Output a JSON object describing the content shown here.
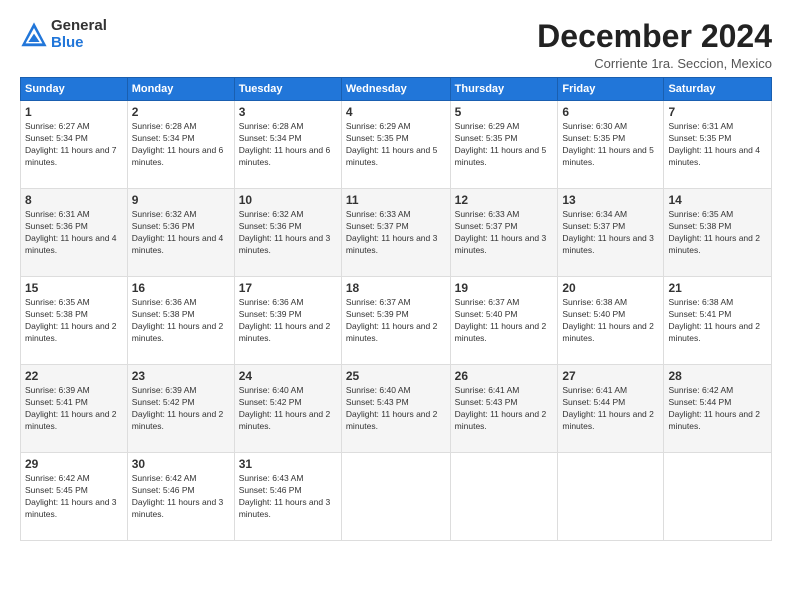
{
  "header": {
    "logo_general": "General",
    "logo_blue": "Blue",
    "month_title": "December 2024",
    "location": "Corriente 1ra. Seccion, Mexico"
  },
  "days_of_week": [
    "Sunday",
    "Monday",
    "Tuesday",
    "Wednesday",
    "Thursday",
    "Friday",
    "Saturday"
  ],
  "weeks": [
    [
      {
        "day": "1",
        "sunrise": "6:27 AM",
        "sunset": "5:34 PM",
        "daylight": "11 hours and 7 minutes."
      },
      {
        "day": "2",
        "sunrise": "6:28 AM",
        "sunset": "5:34 PM",
        "daylight": "11 hours and 6 minutes."
      },
      {
        "day": "3",
        "sunrise": "6:28 AM",
        "sunset": "5:34 PM",
        "daylight": "11 hours and 6 minutes."
      },
      {
        "day": "4",
        "sunrise": "6:29 AM",
        "sunset": "5:35 PM",
        "daylight": "11 hours and 5 minutes."
      },
      {
        "day": "5",
        "sunrise": "6:29 AM",
        "sunset": "5:35 PM",
        "daylight": "11 hours and 5 minutes."
      },
      {
        "day": "6",
        "sunrise": "6:30 AM",
        "sunset": "5:35 PM",
        "daylight": "11 hours and 5 minutes."
      },
      {
        "day": "7",
        "sunrise": "6:31 AM",
        "sunset": "5:35 PM",
        "daylight": "11 hours and 4 minutes."
      }
    ],
    [
      {
        "day": "8",
        "sunrise": "6:31 AM",
        "sunset": "5:36 PM",
        "daylight": "11 hours and 4 minutes."
      },
      {
        "day": "9",
        "sunrise": "6:32 AM",
        "sunset": "5:36 PM",
        "daylight": "11 hours and 4 minutes."
      },
      {
        "day": "10",
        "sunrise": "6:32 AM",
        "sunset": "5:36 PM",
        "daylight": "11 hours and 3 minutes."
      },
      {
        "day": "11",
        "sunrise": "6:33 AM",
        "sunset": "5:37 PM",
        "daylight": "11 hours and 3 minutes."
      },
      {
        "day": "12",
        "sunrise": "6:33 AM",
        "sunset": "5:37 PM",
        "daylight": "11 hours and 3 minutes."
      },
      {
        "day": "13",
        "sunrise": "6:34 AM",
        "sunset": "5:37 PM",
        "daylight": "11 hours and 3 minutes."
      },
      {
        "day": "14",
        "sunrise": "6:35 AM",
        "sunset": "5:38 PM",
        "daylight": "11 hours and 2 minutes."
      }
    ],
    [
      {
        "day": "15",
        "sunrise": "6:35 AM",
        "sunset": "5:38 PM",
        "daylight": "11 hours and 2 minutes."
      },
      {
        "day": "16",
        "sunrise": "6:36 AM",
        "sunset": "5:38 PM",
        "daylight": "11 hours and 2 minutes."
      },
      {
        "day": "17",
        "sunrise": "6:36 AM",
        "sunset": "5:39 PM",
        "daylight": "11 hours and 2 minutes."
      },
      {
        "day": "18",
        "sunrise": "6:37 AM",
        "sunset": "5:39 PM",
        "daylight": "11 hours and 2 minutes."
      },
      {
        "day": "19",
        "sunrise": "6:37 AM",
        "sunset": "5:40 PM",
        "daylight": "11 hours and 2 minutes."
      },
      {
        "day": "20",
        "sunrise": "6:38 AM",
        "sunset": "5:40 PM",
        "daylight": "11 hours and 2 minutes."
      },
      {
        "day": "21",
        "sunrise": "6:38 AM",
        "sunset": "5:41 PM",
        "daylight": "11 hours and 2 minutes."
      }
    ],
    [
      {
        "day": "22",
        "sunrise": "6:39 AM",
        "sunset": "5:41 PM",
        "daylight": "11 hours and 2 minutes."
      },
      {
        "day": "23",
        "sunrise": "6:39 AM",
        "sunset": "5:42 PM",
        "daylight": "11 hours and 2 minutes."
      },
      {
        "day": "24",
        "sunrise": "6:40 AM",
        "sunset": "5:42 PM",
        "daylight": "11 hours and 2 minutes."
      },
      {
        "day": "25",
        "sunrise": "6:40 AM",
        "sunset": "5:43 PM",
        "daylight": "11 hours and 2 minutes."
      },
      {
        "day": "26",
        "sunrise": "6:41 AM",
        "sunset": "5:43 PM",
        "daylight": "11 hours and 2 minutes."
      },
      {
        "day": "27",
        "sunrise": "6:41 AM",
        "sunset": "5:44 PM",
        "daylight": "11 hours and 2 minutes."
      },
      {
        "day": "28",
        "sunrise": "6:42 AM",
        "sunset": "5:44 PM",
        "daylight": "11 hours and 2 minutes."
      }
    ],
    [
      {
        "day": "29",
        "sunrise": "6:42 AM",
        "sunset": "5:45 PM",
        "daylight": "11 hours and 3 minutes."
      },
      {
        "day": "30",
        "sunrise": "6:42 AM",
        "sunset": "5:46 PM",
        "daylight": "11 hours and 3 minutes."
      },
      {
        "day": "31",
        "sunrise": "6:43 AM",
        "sunset": "5:46 PM",
        "daylight": "11 hours and 3 minutes."
      },
      null,
      null,
      null,
      null
    ]
  ]
}
